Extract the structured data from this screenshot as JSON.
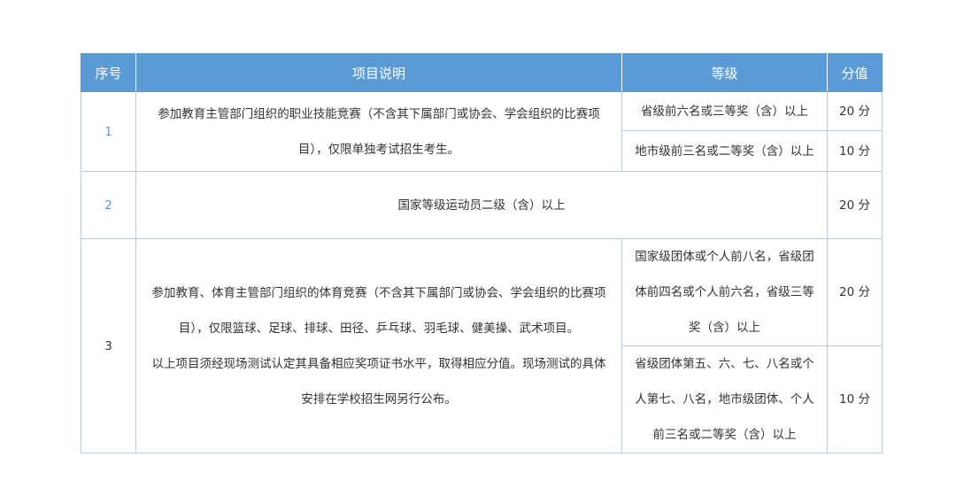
{
  "headers": {
    "seq": "序号",
    "desc": "项目说明",
    "grade": "等级",
    "score": "分值"
  },
  "rows": [
    {
      "seq": "1",
      "desc_lines": [
        "参加教育主管部门组织的职业技能竞赛（不含其下属部门或协会、学会组织的比赛项",
        "目），仅限单独考试招生考生。"
      ],
      "levels": [
        {
          "grade_lines": [
            "省级前六名或三等奖（含）以上"
          ],
          "score": "20 分"
        },
        {
          "grade_lines": [
            "地市级前三名或二等奖（含）以上"
          ],
          "score": "10 分"
        }
      ]
    },
    {
      "seq": "2",
      "desc": "国家等级运动员二级（含）以上",
      "score": "20 分"
    },
    {
      "seq": "3",
      "desc_lines": [
        "参加教育、体育主管部门组织的体育竞赛（不含其下属部门或协会、学会组织的比赛项",
        "目），仅限篮球、足球、排球、田径、乒乓球、羽毛球、健美操、武术项目。",
        "以上项目须经现场测试认定其具备相应奖项证书水平，取得相应分值。现场测试的具体",
        "安排在学校招生网另行公布。"
      ],
      "levels": [
        {
          "grade_lines": [
            "国家级团体或个人前八名，省级团",
            "体前四名或个人前六名，省级三等",
            "奖（含）以上"
          ],
          "score": "20 分"
        },
        {
          "grade_lines": [
            "省级团体第五、六、七、八名或个",
            "人第七、八名，地市级团体、个人",
            "前三名或二等奖（含）以上"
          ],
          "score": "10 分"
        }
      ]
    }
  ]
}
